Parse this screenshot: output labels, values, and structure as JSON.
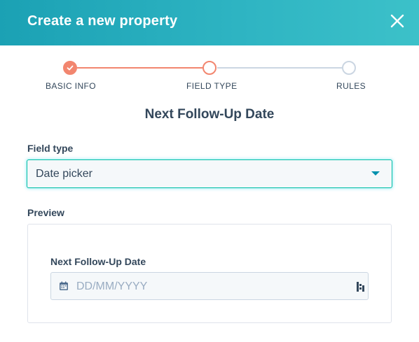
{
  "dialog": {
    "title": "Create a new property",
    "close_icon": "close-icon"
  },
  "stepper": {
    "steps": [
      {
        "label": "BASIC INFO",
        "state": "complete"
      },
      {
        "label": "FIELD TYPE",
        "state": "active"
      },
      {
        "label": "RULES",
        "state": "pending"
      }
    ]
  },
  "property": {
    "name": "Next Follow-Up Date"
  },
  "field_type": {
    "label": "Field type",
    "selected": "Date picker",
    "caret_icon": "caret-down-icon"
  },
  "preview": {
    "label": "Preview",
    "field_label": "Next Follow-Up Date",
    "placeholder": "DD/MM/YYYY",
    "calendar_icon": "calendar-icon",
    "extension_icon": "extension-icon"
  },
  "colors": {
    "header_gradient_start": "#1ba1b4",
    "header_gradient_end": "#3cc1c9",
    "step_complete": "#f2866f",
    "step_pending": "#cbd6e2",
    "focus_border": "#00bda5",
    "text_primary": "#33475b",
    "placeholder": "#99acc2"
  }
}
